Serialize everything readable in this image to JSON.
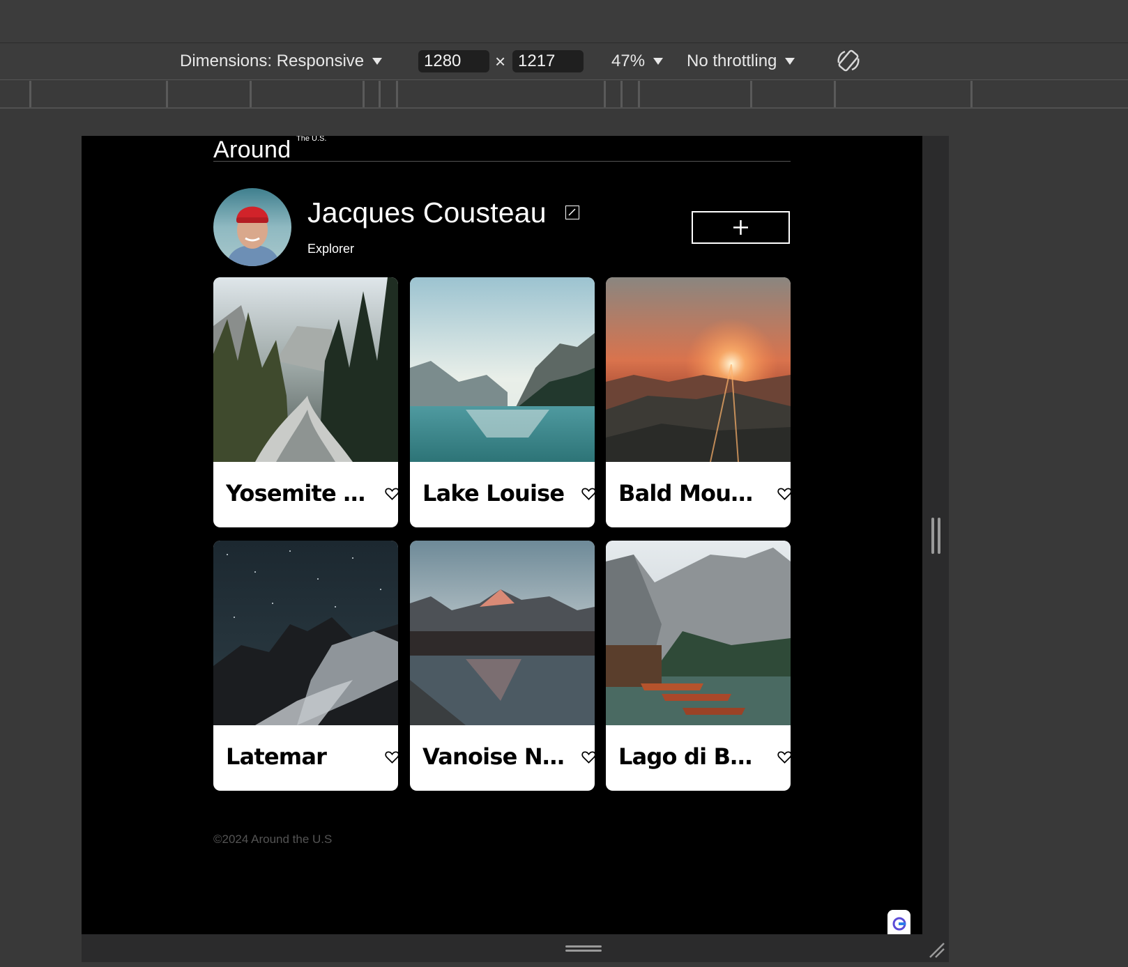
{
  "devtools": {
    "dimensions_label": "Dimensions: Responsive",
    "width_value": "1280",
    "times_symbol": "×",
    "height_value": "1217",
    "zoom_label": "47%",
    "throttling_label": "No throttling"
  },
  "page": {
    "logo": "Around",
    "logo_superscript": "The U.S.",
    "profile": {
      "name": "Jacques Cousteau",
      "about": "Explorer"
    },
    "add_button_symbol": "+",
    "cards": [
      {
        "title": "Yosemite Valley"
      },
      {
        "title": "Lake Louise"
      },
      {
        "title": "Bald Mountains"
      },
      {
        "title": "Latemar"
      },
      {
        "title": "Vanoise National Park"
      },
      {
        "title": "Lago di Braies"
      }
    ],
    "footer": "©2024 Around the U.S"
  }
}
